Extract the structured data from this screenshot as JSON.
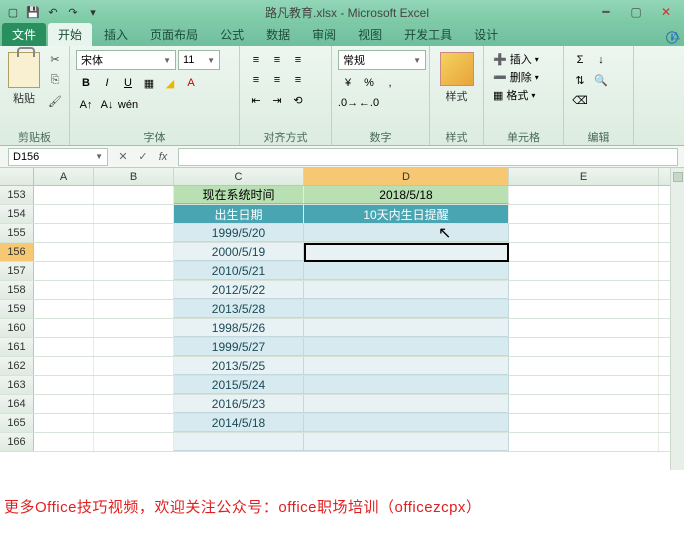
{
  "title": "路凡教育.xlsx - Microsoft Excel",
  "tabs": {
    "file": "文件",
    "home": "开始",
    "insert": "插入",
    "layout": "页面布局",
    "formulas": "公式",
    "data": "数据",
    "review": "审阅",
    "view": "视图",
    "dev": "开发工具",
    "design": "设计"
  },
  "ribbon": {
    "clipboard": {
      "label": "剪贴板",
      "paste": "粘贴"
    },
    "font": {
      "label": "字体",
      "family": "宋体",
      "size": "11"
    },
    "align": {
      "label": "对齐方式"
    },
    "number": {
      "label": "数字",
      "format": "常规"
    },
    "styles": {
      "label": "样式",
      "btn": "样式"
    },
    "cells": {
      "label": "单元格",
      "insert": "插入",
      "delete": "删除",
      "format": "格式"
    },
    "editing": {
      "label": "编辑"
    }
  },
  "namebox": "D156",
  "cols": [
    "A",
    "B",
    "C",
    "D",
    "E"
  ],
  "rownums": [
    "153",
    "154",
    "155",
    "156",
    "157",
    "158",
    "159",
    "160",
    "161",
    "162",
    "163",
    "164",
    "165",
    "166"
  ],
  "header_row": {
    "c": "现在系统时间",
    "d": "2018/5/18"
  },
  "title_row": {
    "c": "出生日期",
    "d": "10天内生日提醒"
  },
  "dates": [
    "1999/5/20",
    "2000/5/19",
    "2010/5/21",
    "2012/5/22",
    "2013/5/28",
    "1998/5/26",
    "1999/5/27",
    "2013/5/25",
    "2015/5/24",
    "2016/5/23",
    "2014/5/18"
  ],
  "footer": "更多Office技巧视频，欢迎关注公众号：office职场培训（officezcpx）"
}
